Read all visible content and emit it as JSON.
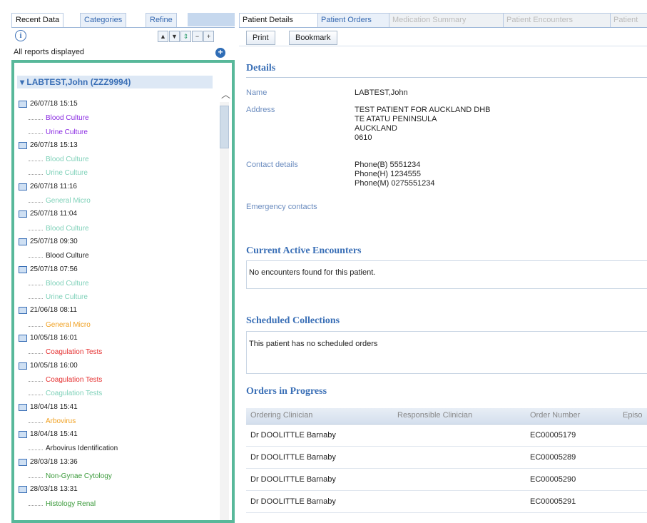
{
  "left_tabs": [
    "Recent Data",
    "Categories",
    "Refine"
  ],
  "toolbar_buttons": [
    "▲",
    "▼",
    "⇕",
    "−",
    "+"
  ],
  "status_text": "All reports displayed",
  "patient_header": "LABTEST,John (ZZZ9994)",
  "tree_items": [
    {
      "kind": "date",
      "text": "26/07/18 15:15"
    },
    {
      "kind": "test",
      "text": "Blood Culture",
      "color": "#8a2be2"
    },
    {
      "kind": "test",
      "text": "Urine Culture",
      "color": "#8a2be2"
    },
    {
      "kind": "date",
      "text": "26/07/18 15:13"
    },
    {
      "kind": "test",
      "text": "Blood Culture",
      "color": "#7fd1b9"
    },
    {
      "kind": "test",
      "text": "Urine Culture",
      "color": "#7fd1b9"
    },
    {
      "kind": "date",
      "text": "26/07/18 11:16"
    },
    {
      "kind": "test",
      "text": "General Micro",
      "color": "#7fd1b9"
    },
    {
      "kind": "date",
      "text": "25/07/18 11:04"
    },
    {
      "kind": "test",
      "text": "Blood Culture",
      "color": "#7fd1b9"
    },
    {
      "kind": "date",
      "text": "25/07/18 09:30"
    },
    {
      "kind": "test",
      "text": "Blood Culture",
      "color": "#222222"
    },
    {
      "kind": "date",
      "text": "25/07/18 07:56"
    },
    {
      "kind": "test",
      "text": "Blood Culture",
      "color": "#7fd1b9"
    },
    {
      "kind": "test",
      "text": "Urine Culture",
      "color": "#7fd1b9"
    },
    {
      "kind": "date",
      "text": "21/06/18 08:11"
    },
    {
      "kind": "test",
      "text": "General Micro",
      "color": "#f0a020"
    },
    {
      "kind": "date",
      "text": "10/05/18 16:01"
    },
    {
      "kind": "test",
      "text": "Coagulation Tests",
      "color": "#e53030"
    },
    {
      "kind": "date",
      "text": "10/05/18 16:00"
    },
    {
      "kind": "test",
      "text": "Coagulation Tests",
      "color": "#e53030"
    },
    {
      "kind": "test",
      "text": "Coagulation Tests",
      "color": "#7fd1b9"
    },
    {
      "kind": "date",
      "text": "18/04/18 15:41"
    },
    {
      "kind": "test",
      "text": "Arbovirus",
      "color": "#f0a020"
    },
    {
      "kind": "date",
      "text": "18/04/18 15:41"
    },
    {
      "kind": "test",
      "text": "Arbovirus Identification",
      "color": "#222222"
    },
    {
      "kind": "date",
      "text": "28/03/18 13:36"
    },
    {
      "kind": "test",
      "text": "Non-Gynae Cytology",
      "color": "#3a9a3a"
    },
    {
      "kind": "date",
      "text": "28/03/18 13:31"
    },
    {
      "kind": "test",
      "text": "Histology Renal",
      "color": "#3a9a3a"
    }
  ],
  "right_tabs": [
    "Patient Details",
    "Patient Orders",
    "Medication Summary",
    "Patient Encounters",
    "Patient"
  ],
  "actions": {
    "print": "Print",
    "bookmark": "Bookmark"
  },
  "details": {
    "heading": "Details",
    "name_label": "Name",
    "name_value": "LABTEST,John",
    "address_label": "Address",
    "address_lines": [
      "TEST PATIENT FOR AUCKLAND DHB",
      "TE ATATU PENINSULA",
      "AUCKLAND",
      "0610"
    ],
    "contact_label": "Contact details",
    "contact_lines": [
      "Phone(B) 5551234",
      "Phone(H) 1234555",
      "Phone(M) 0275551234"
    ],
    "emergency_label": "Emergency contacts"
  },
  "encounters": {
    "heading": "Current Active Encounters",
    "message": "No encounters found for this patient."
  },
  "collections": {
    "heading": "Scheduled Collections",
    "message": "This patient has no scheduled orders"
  },
  "orders": {
    "heading": "Orders in Progress",
    "columns": [
      "Ordering Clinician",
      "Responsible Clinician",
      "Order Number",
      "Episo"
    ],
    "rows": [
      {
        "clinician": "Dr DOOLITTLE Barnaby",
        "order": "EC00005179"
      },
      {
        "clinician": "Dr DOOLITTLE Barnaby",
        "order": "EC00005289"
      },
      {
        "clinician": "Dr DOOLITTLE Barnaby",
        "order": "EC00005290"
      },
      {
        "clinician": "Dr DOOLITTLE Barnaby",
        "order": "EC00005291"
      }
    ]
  }
}
